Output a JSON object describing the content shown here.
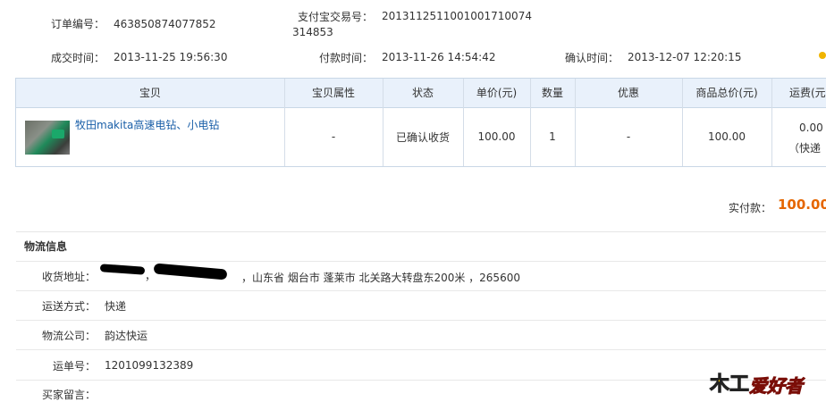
{
  "order": {
    "order_no_label": "订单编号：",
    "order_no": "463850874077852",
    "alipay_label": "支付宝交易号：",
    "alipay_line1": "2013112511001001710074",
    "alipay_line2": "314853",
    "deal_time_label": "成交时间：",
    "deal_time": "2013-11-25 19:56:30",
    "pay_time_label": "付款时间：",
    "pay_time": "2013-11-26 14:54:42",
    "confirm_time_label": "确认时间：",
    "confirm_time": "2013-12-07 12:20:15"
  },
  "table": {
    "headers": [
      "宝贝",
      "宝贝属性",
      "状态",
      "单价(元)",
      "数量",
      "优惠",
      "商品总价(元)",
      "运费(元"
    ],
    "row": {
      "title": "牧田makita高速电钻、小电钻",
      "attr": "-",
      "status": "已确认收货",
      "price": "100.00",
      "qty": "1",
      "discount": "-",
      "total": "100.00",
      "freight": "0.00",
      "freight_note": "（快递",
      "freight_note_tail": ")"
    }
  },
  "paid": {
    "label": "实付款：",
    "amount": "100.00",
    "amount_color": "#e56600"
  },
  "logistics": {
    "title": "物流信息",
    "address_label": "收货地址：",
    "address_text": "，山东省  烟台市  蓬莱市  北关路大转盘东200米  ，265600",
    "address_sep": "，",
    "ship_method_label": "运送方式：",
    "ship_method": "快递",
    "company_label": "物流公司：",
    "company": "韵达快运",
    "waybill_label": "运单号：",
    "waybill": "1201099132389",
    "buyer_msg_label": "买家留言："
  },
  "watermark": {
    "text": "爱好者",
    "prefix": "木工"
  }
}
